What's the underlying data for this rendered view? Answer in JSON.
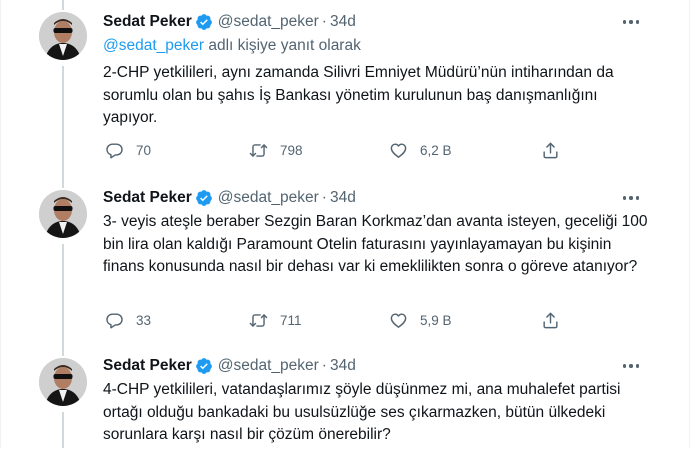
{
  "tweets": [
    {
      "name": "Sedat Peker",
      "handle": "@sedat_peker",
      "time": "34d",
      "reply_to_handle": "@sedat_peker",
      "reply_to_suffix": " adlı kişiye yanıt olarak",
      "text": "2-CHP yetkilileri, aynı zamanda Silivri Emniyet Müdürü’nün intiharından da sorumlu olan bu şahıs İş Bankası yönetim kurulunun baş danışmanlığını yapıyor.",
      "replies": "70",
      "retweets": "798",
      "likes": "6,2 B"
    },
    {
      "name": "Sedat Peker",
      "handle": "@sedat_peker",
      "time": "34d",
      "text": "3- veyis ateşle beraber Sezgin Baran Korkmaz’dan avanta isteyen, geceliği 100 bin lira olan kaldığı Paramount Otelin faturasını yayınlayamayan bu kişinin finans konusunda nasıl bir dehası var ki emeklilikten sonra o göreve atanıyor?",
      "replies": "33",
      "retweets": "711",
      "likes": "5,9 B"
    },
    {
      "name": "Sedat Peker",
      "handle": "@sedat_peker",
      "time": "34d",
      "text": "4-CHP yetkilileri, vatandaşlarımız şöyle düşünmez mi, ana muhalefet partisi ortağı olduğu bankadaki bu usulsüzlüğe ses çıkarmazken, bütün ülkedeki sorunlara karşı nasıl bir çözüm önerebilir?"
    }
  ],
  "dot_separator": "·",
  "colors": {
    "accent": "#1d9bf0",
    "secondary_text": "#536471",
    "thread_line": "#cfd9de"
  },
  "icons": [
    "verified-badge-icon",
    "more-icon",
    "reply-icon",
    "retweet-icon",
    "like-icon",
    "share-icon"
  ]
}
